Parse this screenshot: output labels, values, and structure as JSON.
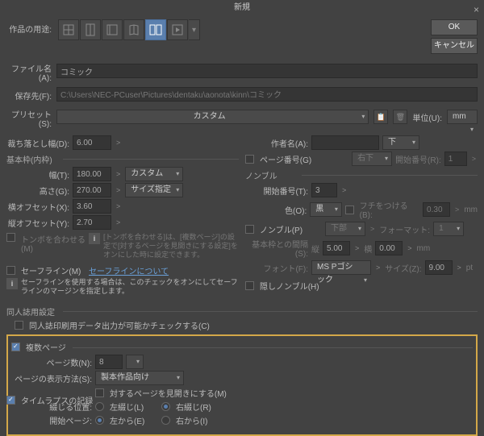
{
  "title": "新規",
  "btn": {
    "ok": "OK",
    "cancel": "キャンセル"
  },
  "labels": {
    "purpose": "作品の用途:",
    "filename": "ファイル名(A):",
    "saveto": "保存先(F):",
    "preset": "プリセット(S):",
    "unit": "単位(U):",
    "author": "作者名(A):"
  },
  "filename_val": "コミック",
  "saveto_val": "C:\\Users\\NEC-PCuser\\Pictures\\dentaku\\aonota\\kinn\\コミック",
  "preset_val": "カスタム",
  "unit_val": "mm",
  "author_sel": "下",
  "left": {
    "bleed_lbl": "裁ち落とし幅(D):",
    "bleed_val": "6.00",
    "basic_hdr": "基本枠(内枠)",
    "w_lbl": "幅(T):",
    "w_val": "180.00",
    "w_sel": "カスタム",
    "h_lbl": "高さ(G):",
    "h_val": "270.00",
    "h_sel": "サイズ指定",
    "xo_lbl": "横オフセット(X):",
    "xo_val": "3.60",
    "yo_lbl": "縦オフセット(Y):",
    "yo_val": "2.70",
    "trim_chk": "トンボを合わせる(M)",
    "trim_info": "[トンボを合わせる]は、[複数ページ]の設定で[対するページを見開きにする設定]をオンにした時に設定できます。",
    "safe_chk": "セーフライン(M)",
    "safe_link": "セーフラインについて",
    "safe_info": "セーフラインを使用する場合は、このチェックをオンにしてセーフラインのマージンを指定します。"
  },
  "doujin": {
    "hdr": "同人誌用設定",
    "chk": "同人誌印刷用データ出力が可能かチェックする(C)"
  },
  "right": {
    "pgnum_chk": "ページ番号(G)",
    "pgnum_pos": "右下",
    "pgnum_start_lbl": "開始番号(R):",
    "pgnum_start_val": "1",
    "nombre_hdr": "ノンブル",
    "nstart_lbl": "開始番号(T):",
    "nstart_val": "3",
    "color_lbl": "色(O):",
    "color_val": "黒",
    "edge_chk": "フチをつける(B):",
    "edge_val": "0.30",
    "mm": "mm",
    "nombre_chk": "ノンブル(P)",
    "nombre_pos": "下部",
    "fmt_lbl": "フォーマット:",
    "fmt_val": "1",
    "gap_lbl": "基本枠との間隔(S):",
    "gap_tate": "縦",
    "gap_tv": "5.00",
    "gap_yoko": "横",
    "gap_yv": "0.00",
    "font_lbl": "フォント(F):",
    "font_val": "MS Pゴシック",
    "size_lbl": "サイズ(Z):",
    "size_val": "9.00",
    "pt": "pt",
    "hide_chk": "隠しノンブル(H)"
  },
  "multi": {
    "hdr": "複数ページ",
    "count_lbl": "ページ数(N):",
    "count_val": "8",
    "disp_lbl": "ページの表示方法(S):",
    "disp_val": "製本作品向け",
    "spread_chk": "対するページを見開きにする(M)",
    "bind_lbl": "綴じる位置:",
    "bind_l": "左綴じ(L)",
    "bind_r": "右綴じ(R)",
    "start_lbl": "開始ページ:",
    "start_l": "左から(E)",
    "start_r": "右から(I)"
  },
  "timelapse": "タイムラプスの記録"
}
